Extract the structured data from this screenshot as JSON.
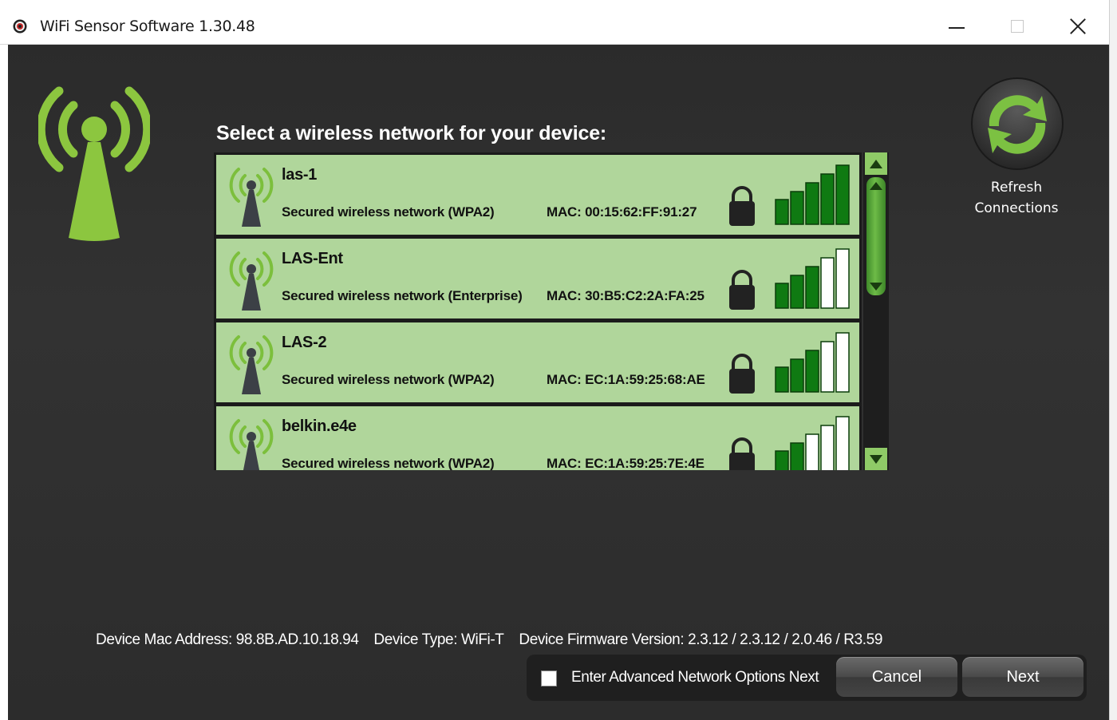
{
  "window": {
    "title": "WiFi Sensor Software 1.30.48"
  },
  "heading": "Select a wireless network for your device:",
  "networks": [
    {
      "ssid": "las-1",
      "security": "Secured wireless network (WPA2)",
      "mac": "MAC: 00:15:62:FF:91:27",
      "signal_bars": 5
    },
    {
      "ssid": "LAS-Ent",
      "security": "Secured wireless network (Enterprise)",
      "mac": "MAC: 30:B5:C2:2A:FA:25",
      "signal_bars": 3
    },
    {
      "ssid": "LAS-2",
      "security": "Secured wireless network (WPA2)",
      "mac": "MAC: EC:1A:59:25:68:AE",
      "signal_bars": 3
    },
    {
      "ssid": "belkin.e4e",
      "security": "Secured wireless network (WPA2)",
      "mac": "MAC: EC:1A:59:25:7E:4E",
      "signal_bars": 2
    }
  ],
  "refresh": {
    "line1": "Refresh",
    "line2": "Connections"
  },
  "device": {
    "mac": "Device Mac Address: 98.8B.AD.10.18.94",
    "type": "Device Type: WiFi-T",
    "firmware": "Device Firmware Version: 2.3.12 / 2.3.12 / 2.0.46 / R3.59"
  },
  "footer": {
    "advanced_label": "Enter Advanced Network Options Next",
    "advanced_checked": false,
    "cancel_label": "Cancel",
    "next_label": "Next"
  },
  "colors": {
    "row_bg": "#b0d69b",
    "accent_green": "#8cc63f",
    "bar_filled": "#0f7a12"
  },
  "icons": {
    "app": "app-logo-icon",
    "antenna": "wifi-antenna-icon",
    "lock": "lock-icon",
    "signal": "signal-strength-icon",
    "refresh": "refresh-icon"
  }
}
